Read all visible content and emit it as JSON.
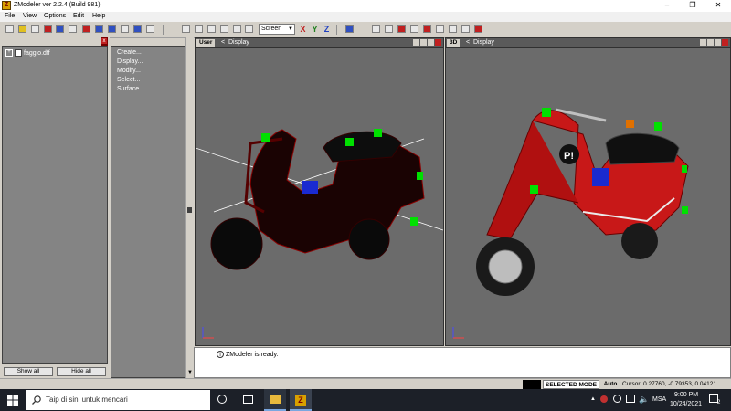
{
  "window": {
    "title": "ZModeler ver 2.2.4 (Build 981)",
    "app_icon": "zmodeler-icon",
    "controls": [
      "minimize-icon",
      "maximize-icon",
      "close-icon"
    ]
  },
  "menu": [
    "File",
    "View",
    "Options",
    "Edit",
    "Help"
  ],
  "toolbar": {
    "view_select": "Screen",
    "axes": [
      {
        "label": "X",
        "color": "#c02020"
      },
      {
        "label": "Y",
        "color": "#208020"
      },
      {
        "label": "Z",
        "color": "#2040c0"
      }
    ]
  },
  "tree": {
    "root": "faggio.dff",
    "show_all": "Show all",
    "hide_all": "Hide all"
  },
  "commands": [
    "Create...",
    "Display...",
    "Modify...",
    "Select...",
    "Surface..."
  ],
  "viewports": {
    "user": {
      "tag": "User",
      "display": "Display"
    },
    "persp": {
      "tag": "3D",
      "display": "Display"
    }
  },
  "log": {
    "message": "ZModeler is ready."
  },
  "status": {
    "mode": "SELECTED MODE",
    "auto": "Auto",
    "cursor": "Cursor: 0.27760, -0.79353, 0.04121"
  },
  "taskbar": {
    "search_placeholder": "Taip di sini untuk mencari",
    "lang": "MSA",
    "time": "9:00 PM",
    "date": "10/24/2021",
    "notification_count": "2"
  },
  "colors": {
    "viewport_bg": "#6b6b6b",
    "scooter_red": "#c81818",
    "handle_green": "#00e000",
    "pivot_blue": "#1a2ad0",
    "taskbar": "#1c2028"
  }
}
